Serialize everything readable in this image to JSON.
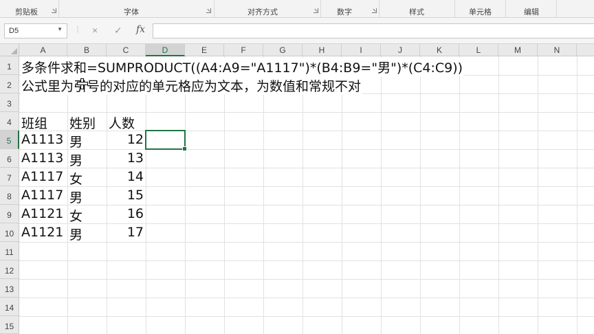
{
  "ribbon": {
    "groups": [
      "剪贴板",
      "字体",
      "对齐方式",
      "数字",
      "样式",
      "单元格",
      "编辑"
    ]
  },
  "formula_bar": {
    "name_box": "D5",
    "cancel_icon": "×",
    "enter_icon": "✓",
    "fx_label": "fx",
    "formula": ""
  },
  "sheet": {
    "columns": [
      "A",
      "B",
      "C",
      "D",
      "E",
      "F",
      "G",
      "H",
      "I",
      "J",
      "K",
      "L",
      "M",
      "N"
    ],
    "rows": [
      "1",
      "2",
      "3",
      "4",
      "5",
      "6",
      "7",
      "8",
      "9",
      "10",
      "11",
      "12",
      "13",
      "14",
      "15"
    ],
    "selected_cell": "D5",
    "row1_text": "多条件求和=SUMPRODUCT((A4:A9=\"A1117\")*(B4:B9=\"男\")*(C4:C9))",
    "row2_text": "公式里为引号的对应的单元格应为文本，为数值和常规不对",
    "headers": [
      "班组",
      "姓别",
      "人数"
    ],
    "data_rows": [
      [
        "A1113",
        "男",
        "12"
      ],
      [
        "A1113",
        "男",
        "13"
      ],
      [
        "A1117",
        "女",
        "14"
      ],
      [
        "A1117",
        "男",
        "15"
      ],
      [
        "A1121",
        "女",
        "16"
      ],
      [
        "A1121",
        "男",
        "17"
      ]
    ]
  }
}
